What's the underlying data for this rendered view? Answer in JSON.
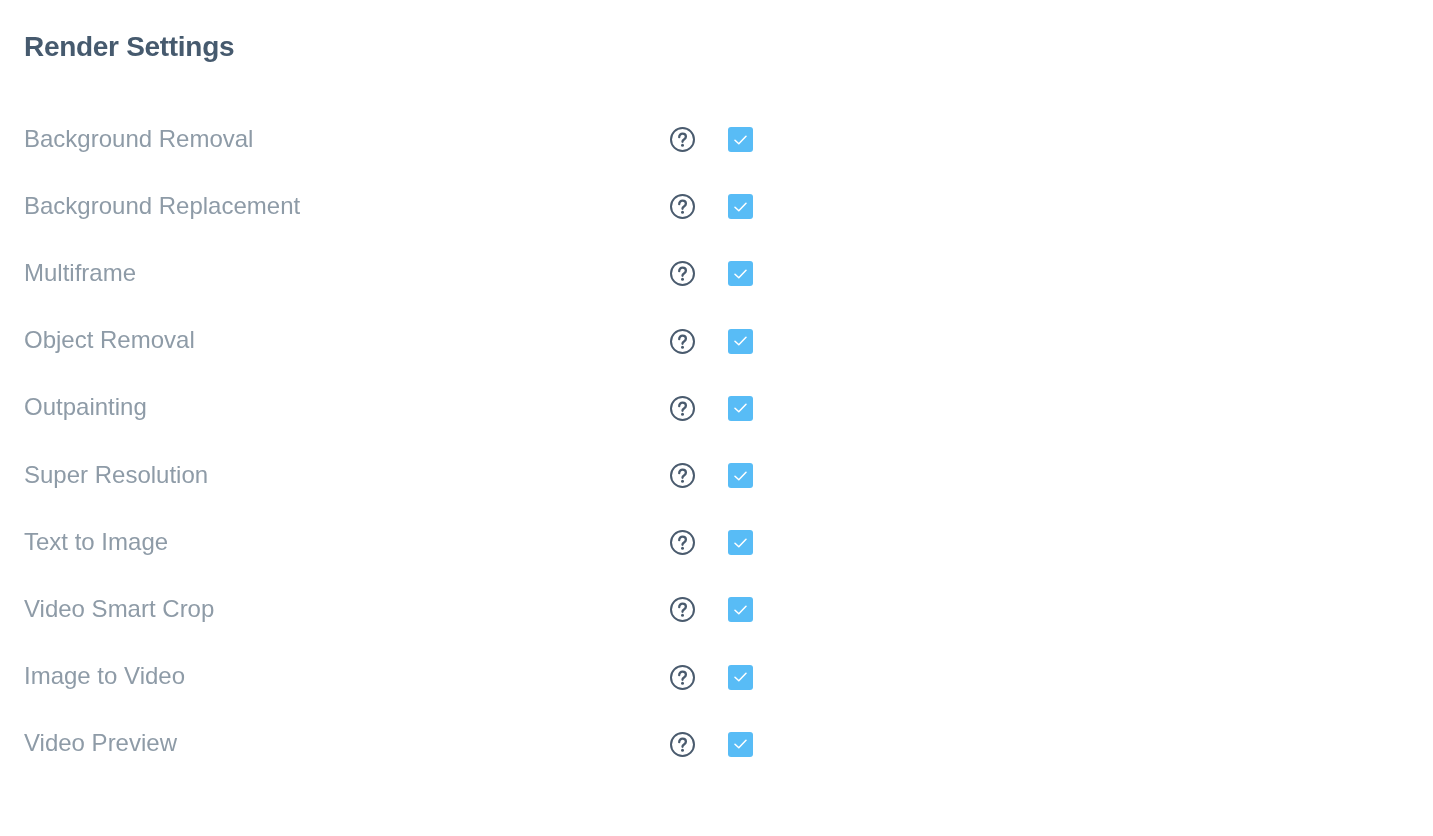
{
  "title": "Render Settings",
  "settings": [
    {
      "label": "Background Removal",
      "checked": true
    },
    {
      "label": "Background Replacement",
      "checked": true
    },
    {
      "label": "Multiframe",
      "checked": true
    },
    {
      "label": "Object Removal",
      "checked": true
    },
    {
      "label": "Outpainting",
      "checked": true
    },
    {
      "label": "Super Resolution",
      "checked": true
    },
    {
      "label": "Text to Image",
      "checked": true
    },
    {
      "label": "Video Smart Crop",
      "checked": true
    },
    {
      "label": "Image to Video",
      "checked": true
    },
    {
      "label": "Video Preview",
      "checked": true
    }
  ]
}
